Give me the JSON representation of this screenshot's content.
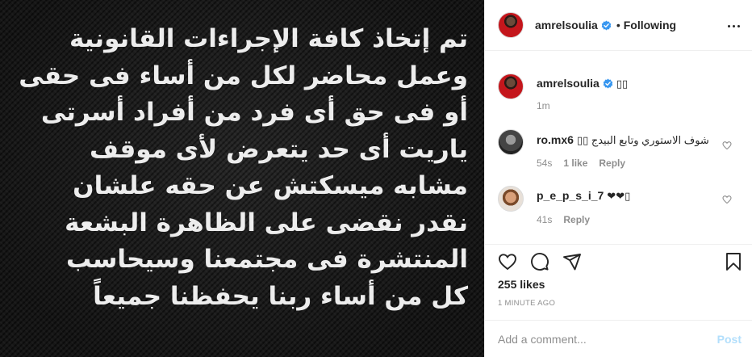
{
  "media": {
    "lines": [
      "تم إتخاذ كافة الإجراءات القانونية",
      "وعمل محاضر لكل من أساء فى حقى",
      "أو فى حق أى فرد من أفراد أسرتى",
      "ياريت أى حد يتعرض لأى موقف",
      "مشابه ميسكتش عن حقه علشان",
      "نقدر نقضى على الظاهرة البشعة",
      "المنتشرة فى مجتمعنا وسيحاسب",
      "كل من أساء ربنا يحفظنا جميعاً"
    ]
  },
  "header": {
    "username": "amrelsoulia",
    "dot": "•",
    "following_label": "Following"
  },
  "caption": {
    "username": "amrelsoulia",
    "text": "▯▯",
    "time": "1m"
  },
  "comments": [
    {
      "username": "ro.mx6",
      "text": "شوف الاستوري وتابع البيدج ▯▯",
      "time": "54s",
      "likes": "1 like",
      "reply": "Reply"
    },
    {
      "username": "p_e_p_s_i_7",
      "text": "❤❤▯",
      "time": "41s",
      "likes": "",
      "reply": "Reply"
    }
  ],
  "post_info": {
    "likes": "255 likes",
    "timestamp": "1 MINUTE AGO"
  },
  "add_comment": {
    "placeholder": "Add a comment...",
    "post_label": "Post"
  },
  "colors": {
    "verified": "#3897f0",
    "post_disabled": "#b2dffc",
    "meta_gray": "#8e8e8e"
  },
  "icons": [
    "heart-icon",
    "comment-icon",
    "share-icon",
    "bookmark-icon",
    "more-options-icon",
    "verified-badge-icon"
  ]
}
